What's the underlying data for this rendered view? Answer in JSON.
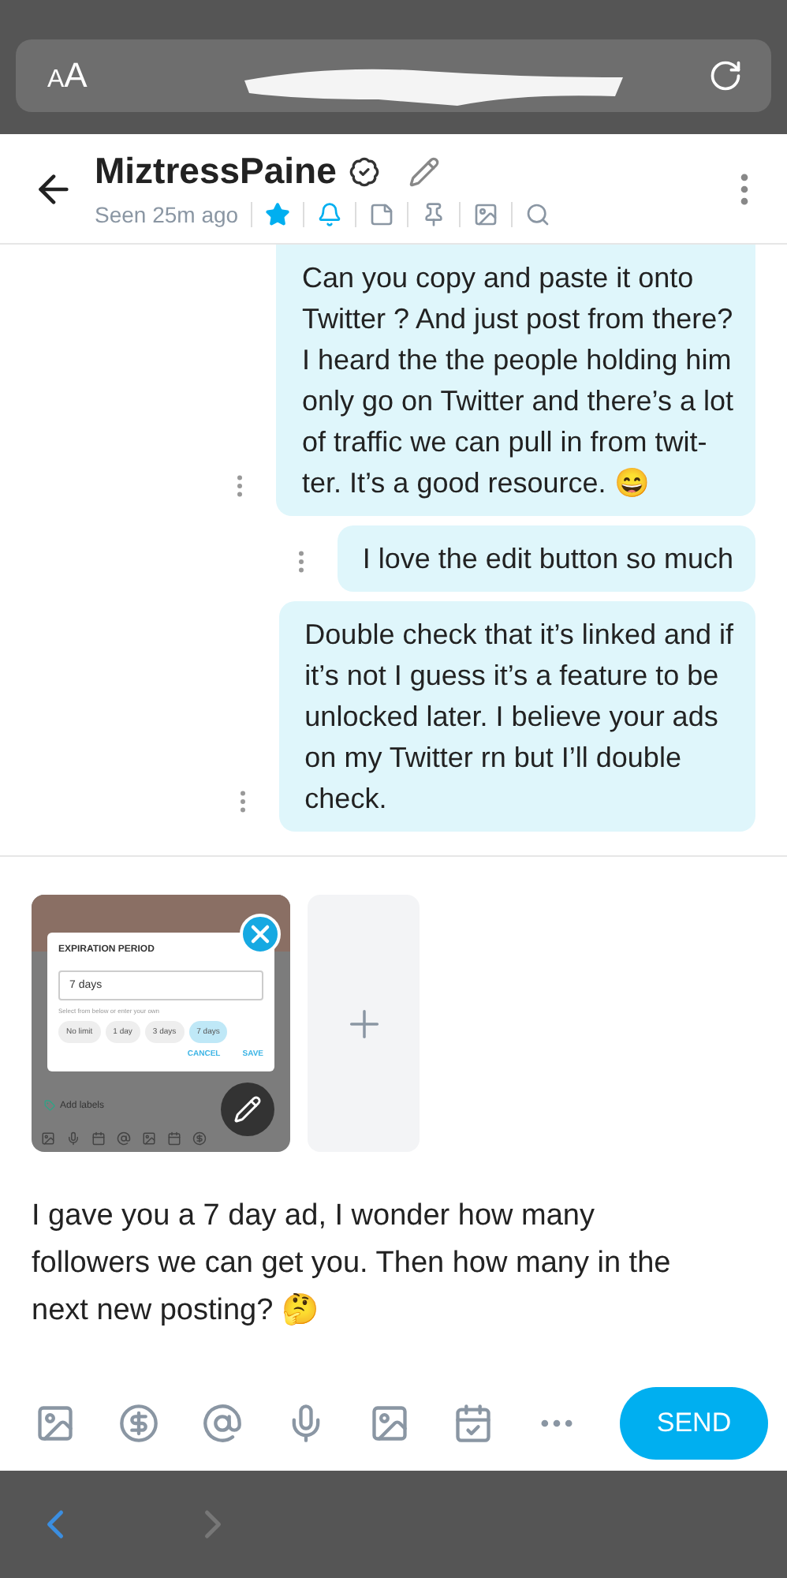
{
  "browser": {
    "text_size": "AA"
  },
  "chat": {
    "name": "MiztressPaine",
    "verified": true,
    "status": "Seen 25m ago",
    "favorite": true,
    "notifications": true
  },
  "messages": [
    {
      "lines": [
        "Can you copy and paste it onto",
        "Twitter ? And just post from there?",
        "I heard the the people holding him",
        "only go on Twitter and there’s a lot",
        "of traffic we can pull in from twit-",
        "ter. It’s a good resource. 😄"
      ]
    },
    {
      "lines": [
        "I love the edit button so much"
      ]
    },
    {
      "lines": [
        "Double check that it’s linked and if",
        "it’s not I guess it’s a feature to be",
        "unlocked later. I believe your ads",
        "on my Twitter rn but I’ll double",
        "check."
      ]
    }
  ],
  "attachment": {
    "dialog_title": "EXPIRATION PERIOD",
    "value": "7 days",
    "hint": "Select from below or enter your own",
    "chips": [
      {
        "label": "No limit",
        "selected": false
      },
      {
        "label": "1 day",
        "selected": false
      },
      {
        "label": "3 days",
        "selected": false
      },
      {
        "label": "7 days",
        "selected": true
      }
    ],
    "buttons": [
      "CANCEL",
      "SAVE"
    ],
    "add_labels": "Add labels"
  },
  "composer": {
    "lines": [
      "I gave you a 7 day ad, I wonder how many",
      "followers we can get you. Then how many in the",
      "next new posting? 🤔"
    ],
    "send": "SEND"
  }
}
